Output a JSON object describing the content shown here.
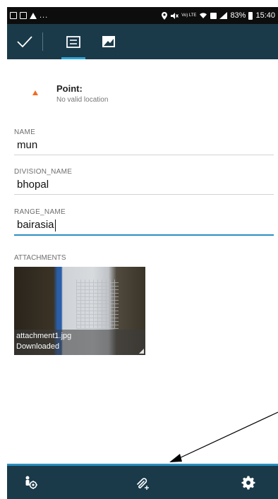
{
  "status_bar": {
    "left_dots": "...",
    "network_label": "Vo) LTE",
    "battery_percent": "83%",
    "time": "15:40"
  },
  "toolbar": {
    "tabs": [
      {
        "icon": "checkmark-icon"
      },
      {
        "icon": "form-icon",
        "active": true
      },
      {
        "icon": "map-photo-icon"
      }
    ]
  },
  "feature": {
    "geometry_title": "Point:",
    "geometry_status": "No valid location"
  },
  "fields": [
    {
      "label": "NAME",
      "value": "mun"
    },
    {
      "label": "DIVISION_NAME",
      "value": "bhopal"
    },
    {
      "label": "RANGE_NAME",
      "value": "bairasia",
      "focused": true
    }
  ],
  "attachments": {
    "label": "ATTACHMENTS",
    "items": [
      {
        "filename": "attachment1.jpg",
        "status": "Downloaded"
      }
    ]
  },
  "bottom_bar": {
    "buttons": [
      {
        "icon": "location-person-icon"
      },
      {
        "icon": "add-attachment-icon"
      },
      {
        "icon": "settings-gear-icon"
      }
    ]
  },
  "colors": {
    "toolbar_bg": "#1a3a4a",
    "accent_blue": "#2a8fc0",
    "marker_orange": "#f26b21"
  }
}
